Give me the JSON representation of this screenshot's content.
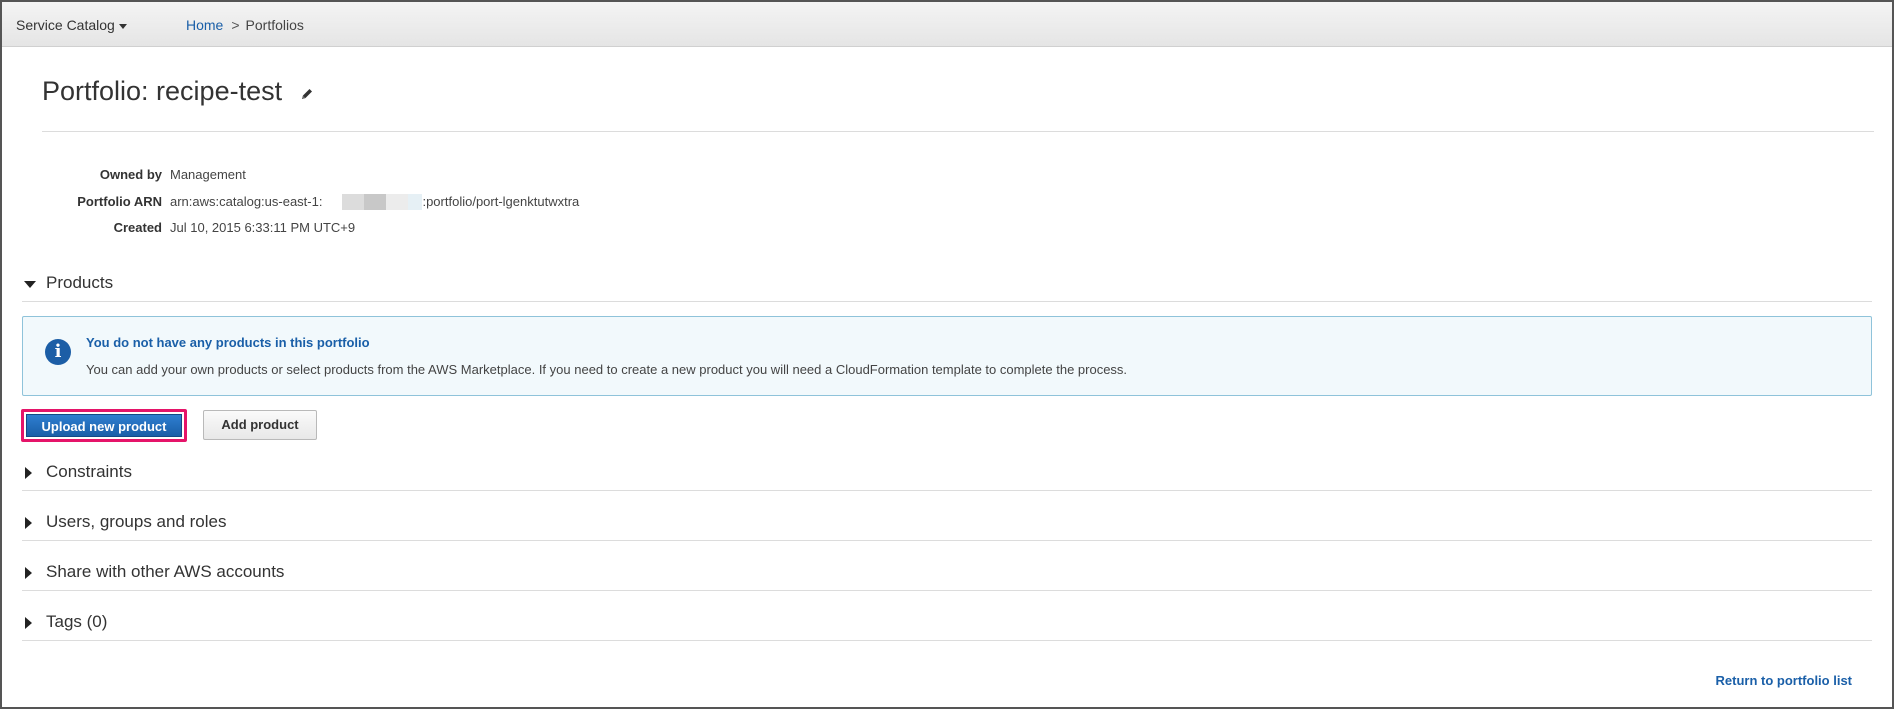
{
  "topbar": {
    "service_menu": "Service Catalog",
    "breadcrumb": {
      "home": "Home",
      "separator": ">",
      "current": "Portfolios"
    }
  },
  "portfolio": {
    "title": "Portfolio: recipe-test",
    "meta": [
      {
        "key": "Owned by",
        "value": "Management"
      },
      {
        "key": "Portfolio ARN",
        "value_prefix": "arn:aws:catalog:us-east-1:",
        "value_suffix": ":portfolio/port-lgenktutwxtra"
      },
      {
        "key": "Created",
        "value": "Jul 10, 2015 6:33:11 PM UTC+9"
      }
    ]
  },
  "sections": {
    "products": "Products",
    "constraints": "Constraints",
    "users": "Users, groups and roles",
    "share": "Share with other AWS accounts",
    "tags": "Tags (0)"
  },
  "info": {
    "title": "You do not have any products in this portfolio",
    "body": "You can add your own products or select products from the AWS Marketplace. If you need to create a new product you will need a CloudFormation template to complete the process."
  },
  "buttons": {
    "upload": "Upload new product",
    "add": "Add product"
  },
  "footer": {
    "return_link": "Return to portfolio list"
  },
  "colors": {
    "accent": "#1a5fa8",
    "highlight": "#e51469",
    "info_bg": "#f2f9fc"
  }
}
